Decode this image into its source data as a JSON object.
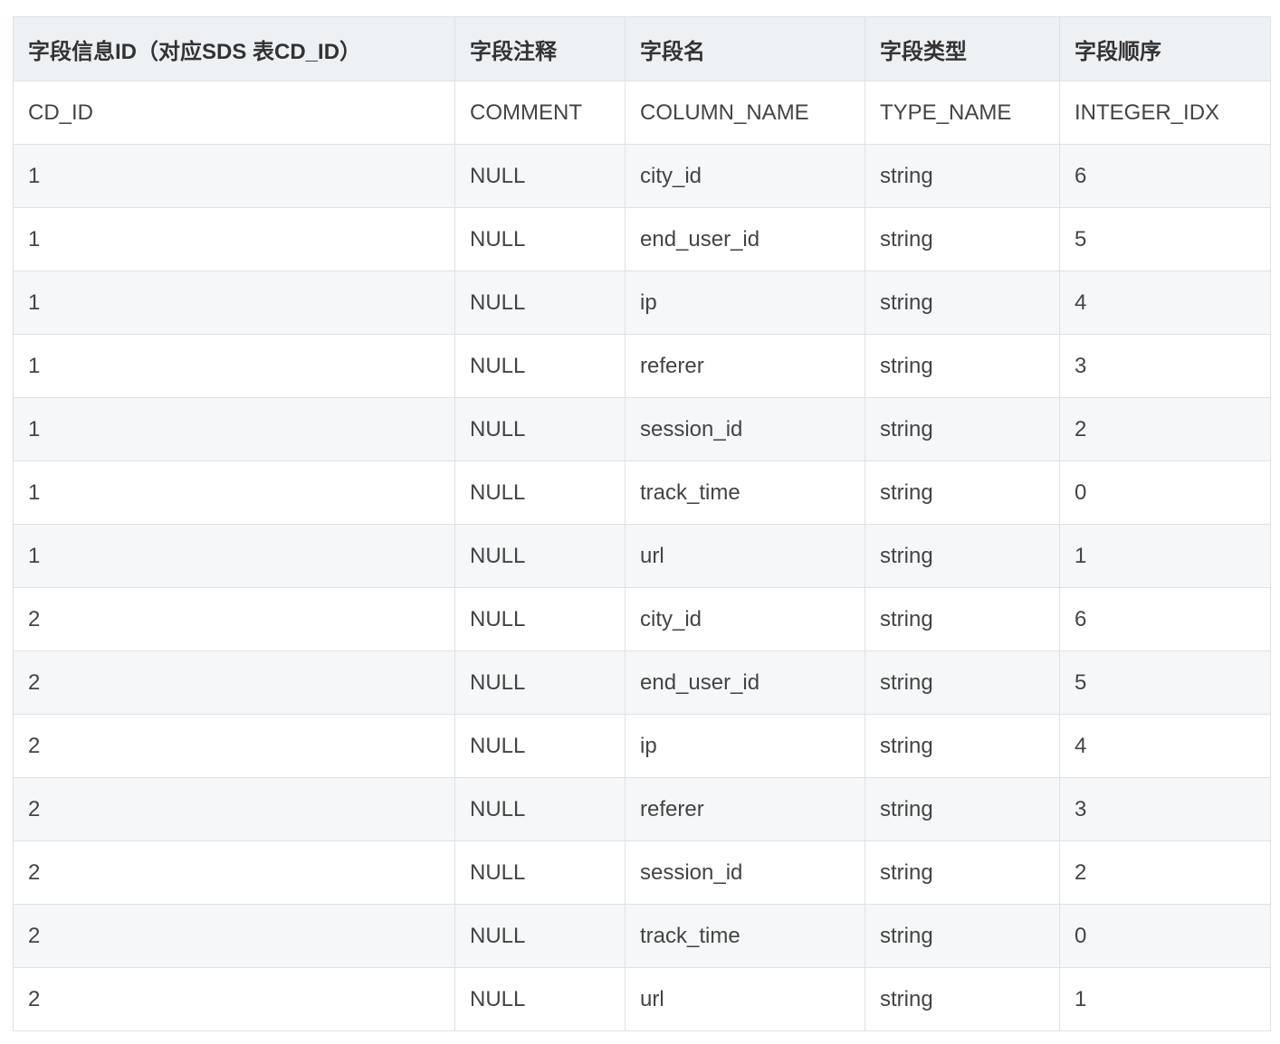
{
  "table": {
    "headers": [
      "字段信息ID（对应SDS 表CD_ID）",
      "字段注释",
      "字段名",
      "字段类型",
      "字段顺序"
    ],
    "rows": [
      [
        "CD_ID",
        "COMMENT",
        "COLUMN_NAME",
        "TYPE_NAME",
        "INTEGER_IDX"
      ],
      [
        "1",
        "NULL",
        "city_id",
        "string",
        "6"
      ],
      [
        "1",
        "NULL",
        "end_user_id",
        "string",
        "5"
      ],
      [
        "1",
        "NULL",
        "ip",
        "string",
        "4"
      ],
      [
        "1",
        "NULL",
        "referer",
        "string",
        "3"
      ],
      [
        "1",
        "NULL",
        "session_id",
        "string",
        "2"
      ],
      [
        "1",
        "NULL",
        "track_time",
        "string",
        "0"
      ],
      [
        "1",
        "NULL",
        "url",
        "string",
        "1"
      ],
      [
        "2",
        "NULL",
        "city_id",
        "string",
        "6"
      ],
      [
        "2",
        "NULL",
        "end_user_id",
        "string",
        "5"
      ],
      [
        "2",
        "NULL",
        "ip",
        "string",
        "4"
      ],
      [
        "2",
        "NULL",
        "referer",
        "string",
        "3"
      ],
      [
        "2",
        "NULL",
        "session_id",
        "string",
        "2"
      ],
      [
        "2",
        "NULL",
        "track_time",
        "string",
        "0"
      ],
      [
        "2",
        "NULL",
        "url",
        "string",
        "1"
      ]
    ]
  }
}
